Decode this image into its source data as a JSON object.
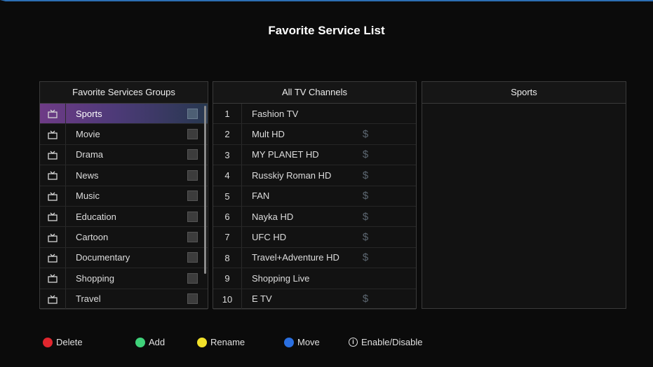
{
  "title": "Favorite Service List",
  "groups_panel": {
    "header": "Favorite Services Groups",
    "items": [
      {
        "label": "Sports",
        "selected": true
      },
      {
        "label": "Movie"
      },
      {
        "label": "Drama"
      },
      {
        "label": "News"
      },
      {
        "label": "Music"
      },
      {
        "label": "Education"
      },
      {
        "label": "Cartoon"
      },
      {
        "label": "Documentary"
      },
      {
        "label": "Shopping"
      },
      {
        "label": "Travel"
      }
    ]
  },
  "channels_panel": {
    "header": "All TV Channels",
    "items": [
      {
        "num": "1",
        "name": "Fashion TV",
        "paid": ""
      },
      {
        "num": "2",
        "name": "Mult HD",
        "paid": "$"
      },
      {
        "num": "3",
        "name": "MY PLANET HD",
        "paid": "$"
      },
      {
        "num": "4",
        "name": "Russkiy Roman HD",
        "paid": "$"
      },
      {
        "num": "5",
        "name": "FAN",
        "paid": "$"
      },
      {
        "num": "6",
        "name": "Nayka HD",
        "paid": "$"
      },
      {
        "num": "7",
        "name": "UFC HD",
        "paid": "$"
      },
      {
        "num": "8",
        "name": "Travel+Adventure HD",
        "paid": "$"
      },
      {
        "num": "9",
        "name": "Shopping Live",
        "paid": ""
      },
      {
        "num": "10",
        "name": "E TV",
        "paid": "$"
      }
    ]
  },
  "group_contents_panel": {
    "header": "Sports",
    "items": []
  },
  "footer": {
    "delete": {
      "label": "Delete",
      "color": "#e0262e"
    },
    "add": {
      "label": "Add",
      "color": "#3fd27a"
    },
    "rename": {
      "label": "Rename",
      "color": "#f2e12a"
    },
    "move": {
      "label": "Move",
      "color": "#2a6fe0"
    },
    "enable": {
      "label": "Enable/Disable",
      "icon": "info-icon"
    }
  }
}
